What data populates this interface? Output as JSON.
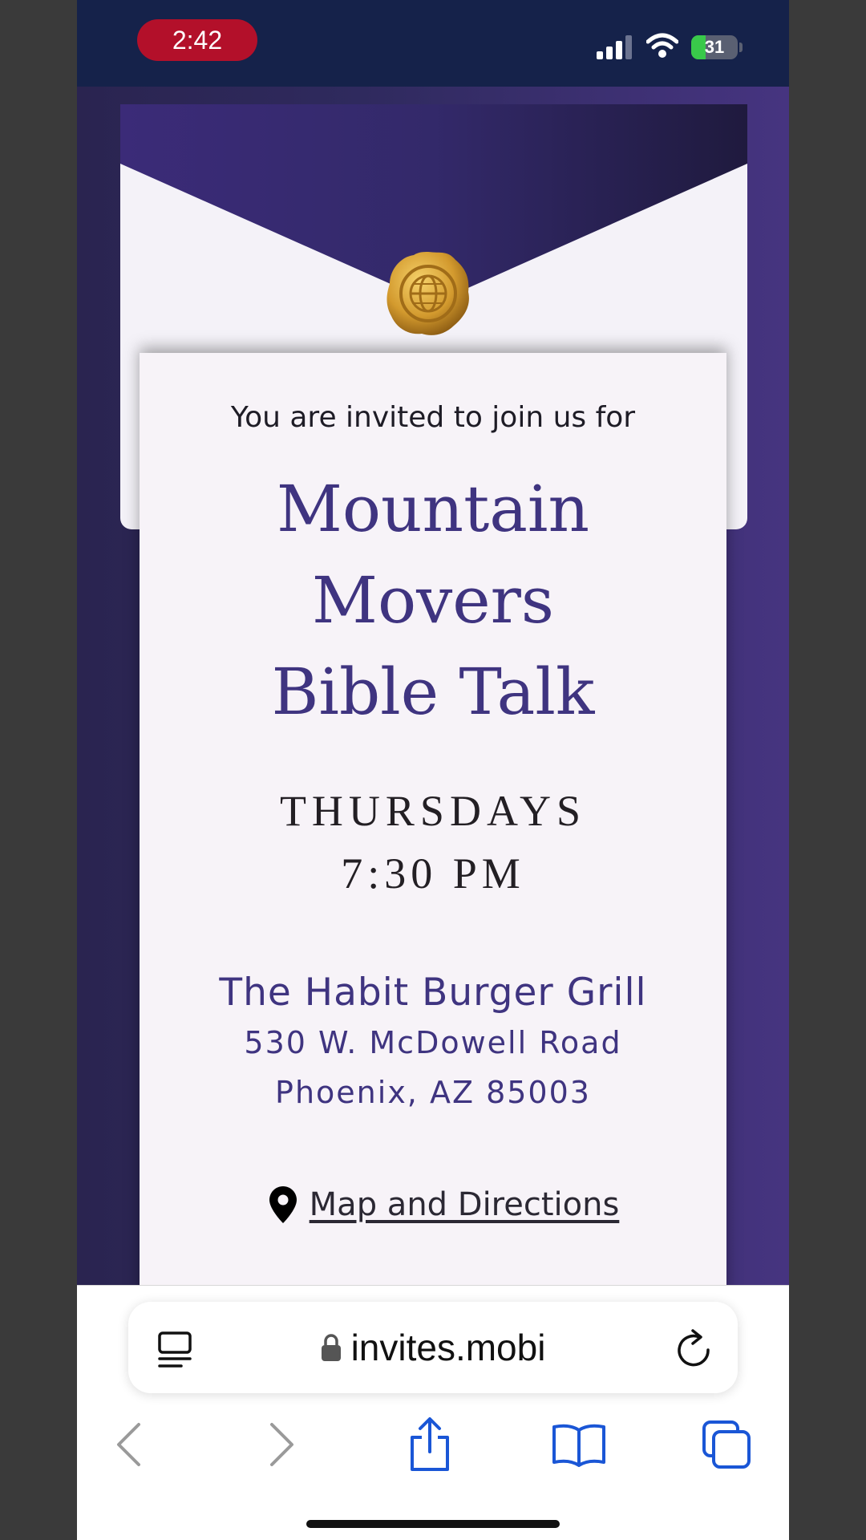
{
  "status_bar": {
    "time": "2:42",
    "battery_percent": "31",
    "battery_level": 0.31,
    "icons": [
      "signal-icon",
      "wifi-icon",
      "battery-charging-icon"
    ],
    "bar_color": "#15224a",
    "time_pill_color": "#b3102a"
  },
  "invite": {
    "intro": "You are invited to join us for",
    "title_lines": [
      "Mountain",
      "Movers",
      "Bible Talk"
    ],
    "day": "THURSDAYS",
    "time": "7:30 PM",
    "venue": "The Habit Burger Grill",
    "address_line1": "530 W. McDowell Road",
    "address_line2": "Phoenix, AZ 85003",
    "map_link": "Map and Directions",
    "accent_color": "#3f3480",
    "seal_icon": "globe-wax-seal-icon"
  },
  "browser": {
    "url": "invites.mobi",
    "toolbar": [
      "back-icon",
      "forward-icon",
      "share-icon",
      "bookmarks-icon",
      "tabs-icon"
    ],
    "accent_color": "#1a56d6"
  }
}
